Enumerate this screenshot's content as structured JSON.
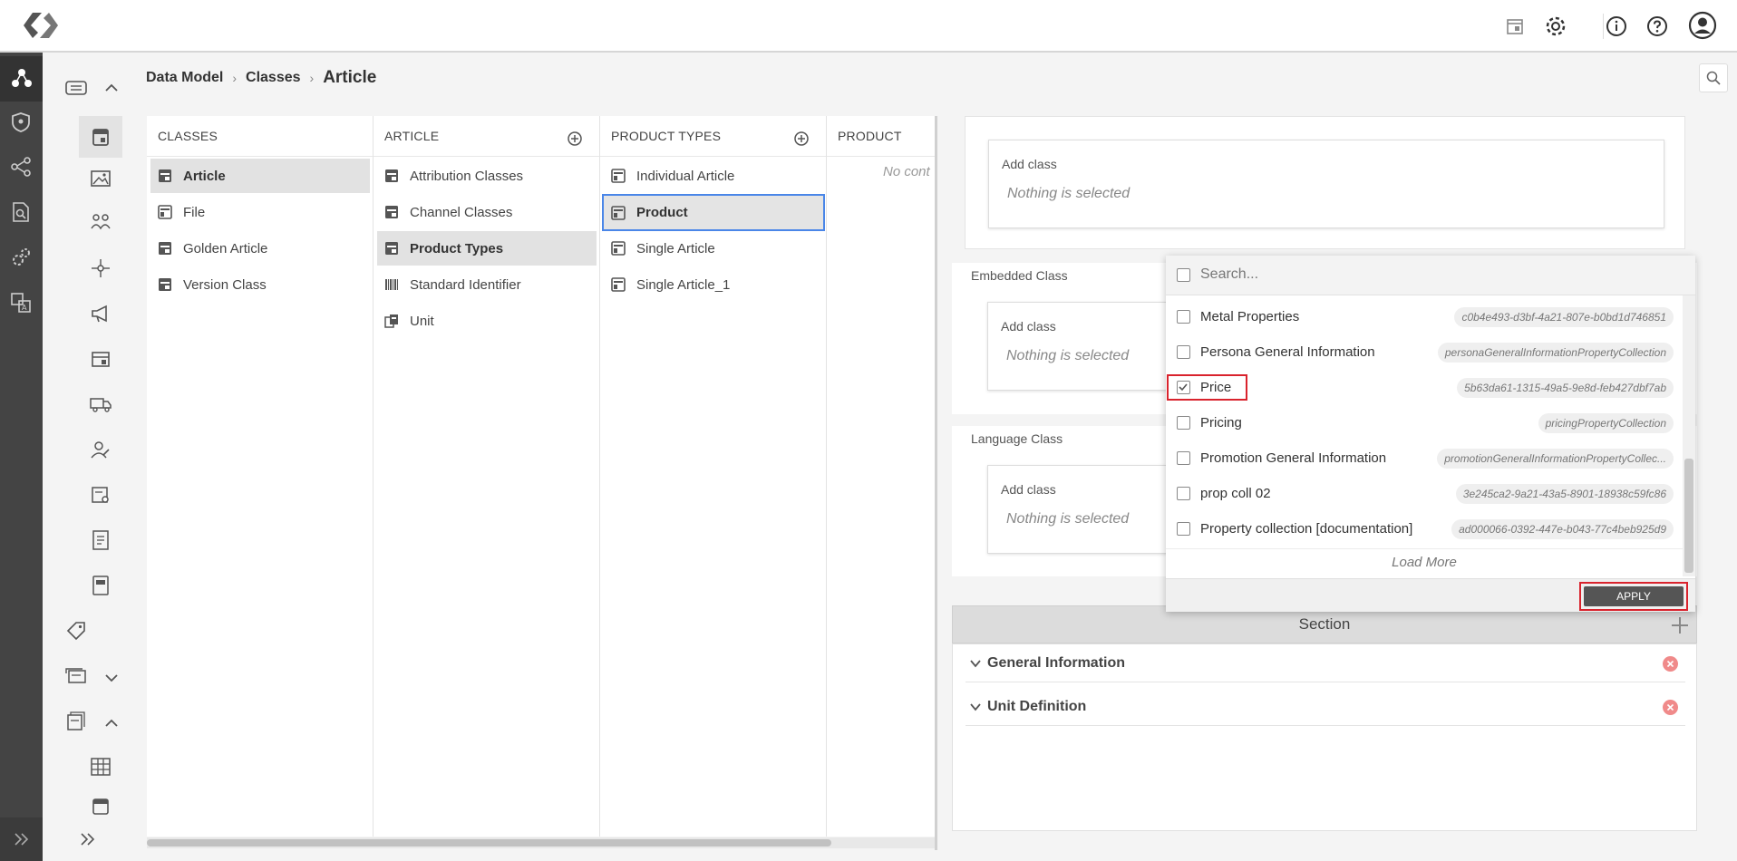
{
  "breadcrumb": {
    "item1": "Data Model",
    "item2": "Classes",
    "current": "Article",
    "sep": "›"
  },
  "columns": {
    "classes": {
      "header": "CLASSES",
      "items": [
        "Article",
        "File",
        "Golden Article",
        "Version Class"
      ],
      "selected": "Article"
    },
    "article": {
      "header": "ARTICLE",
      "items": [
        "Attribution Classes",
        "Channel Classes",
        "Product Types",
        "Standard Identifier",
        "Unit"
      ],
      "selected": "Product Types"
    },
    "product_types": {
      "header": "PRODUCT TYPES",
      "items": [
        "Individual Article",
        "Product",
        "Single Article",
        "Single Article_1"
      ],
      "selected": "Product"
    },
    "product": {
      "header": "PRODUCT",
      "empty_text": "No cont"
    }
  },
  "right_panel": {
    "cards": [
      {
        "label": "",
        "add_class": "Add class",
        "placeholder": "Nothing is selected"
      },
      {
        "label": "Embedded Class",
        "add_class": "Add class",
        "placeholder": "Nothing is selected"
      },
      {
        "label": "Language Class",
        "add_class": "Add class",
        "placeholder": "Nothing is selected"
      }
    ]
  },
  "dropdown": {
    "search_placeholder": "Search...",
    "options": [
      {
        "label": "Metal Properties",
        "code": "c0b4e493-d3bf-4a21-807e-b0bd1d746851",
        "checked": false
      },
      {
        "label": "Persona General Information",
        "code": "personaGeneralInformationPropertyCollection",
        "checked": false
      },
      {
        "label": "Price",
        "code": "5b63da61-1315-49a5-9e8d-feb427dbf7ab",
        "checked": true
      },
      {
        "label": "Pricing",
        "code": "pricingPropertyCollection",
        "checked": false
      },
      {
        "label": "Promotion General Information",
        "code": "promotionGeneralInformationPropertyCollec...",
        "checked": false
      },
      {
        "label": "prop coll 02",
        "code": "3e245ca2-9a21-43a5-8901-18938c59fc86",
        "checked": false
      },
      {
        "label": "Property collection [documentation]",
        "code": "ad000066-0392-447e-b043-77c4beb925d9",
        "checked": false
      }
    ],
    "load_more": "Load More",
    "apply": "APPLY"
  },
  "section": {
    "title": "Section",
    "items": [
      "General Information",
      "Unit Definition"
    ]
  },
  "colors": {
    "rail": "#444444",
    "highlight": "#d9232d",
    "focus": "#4a86e8",
    "remove": "#f08a8a"
  }
}
